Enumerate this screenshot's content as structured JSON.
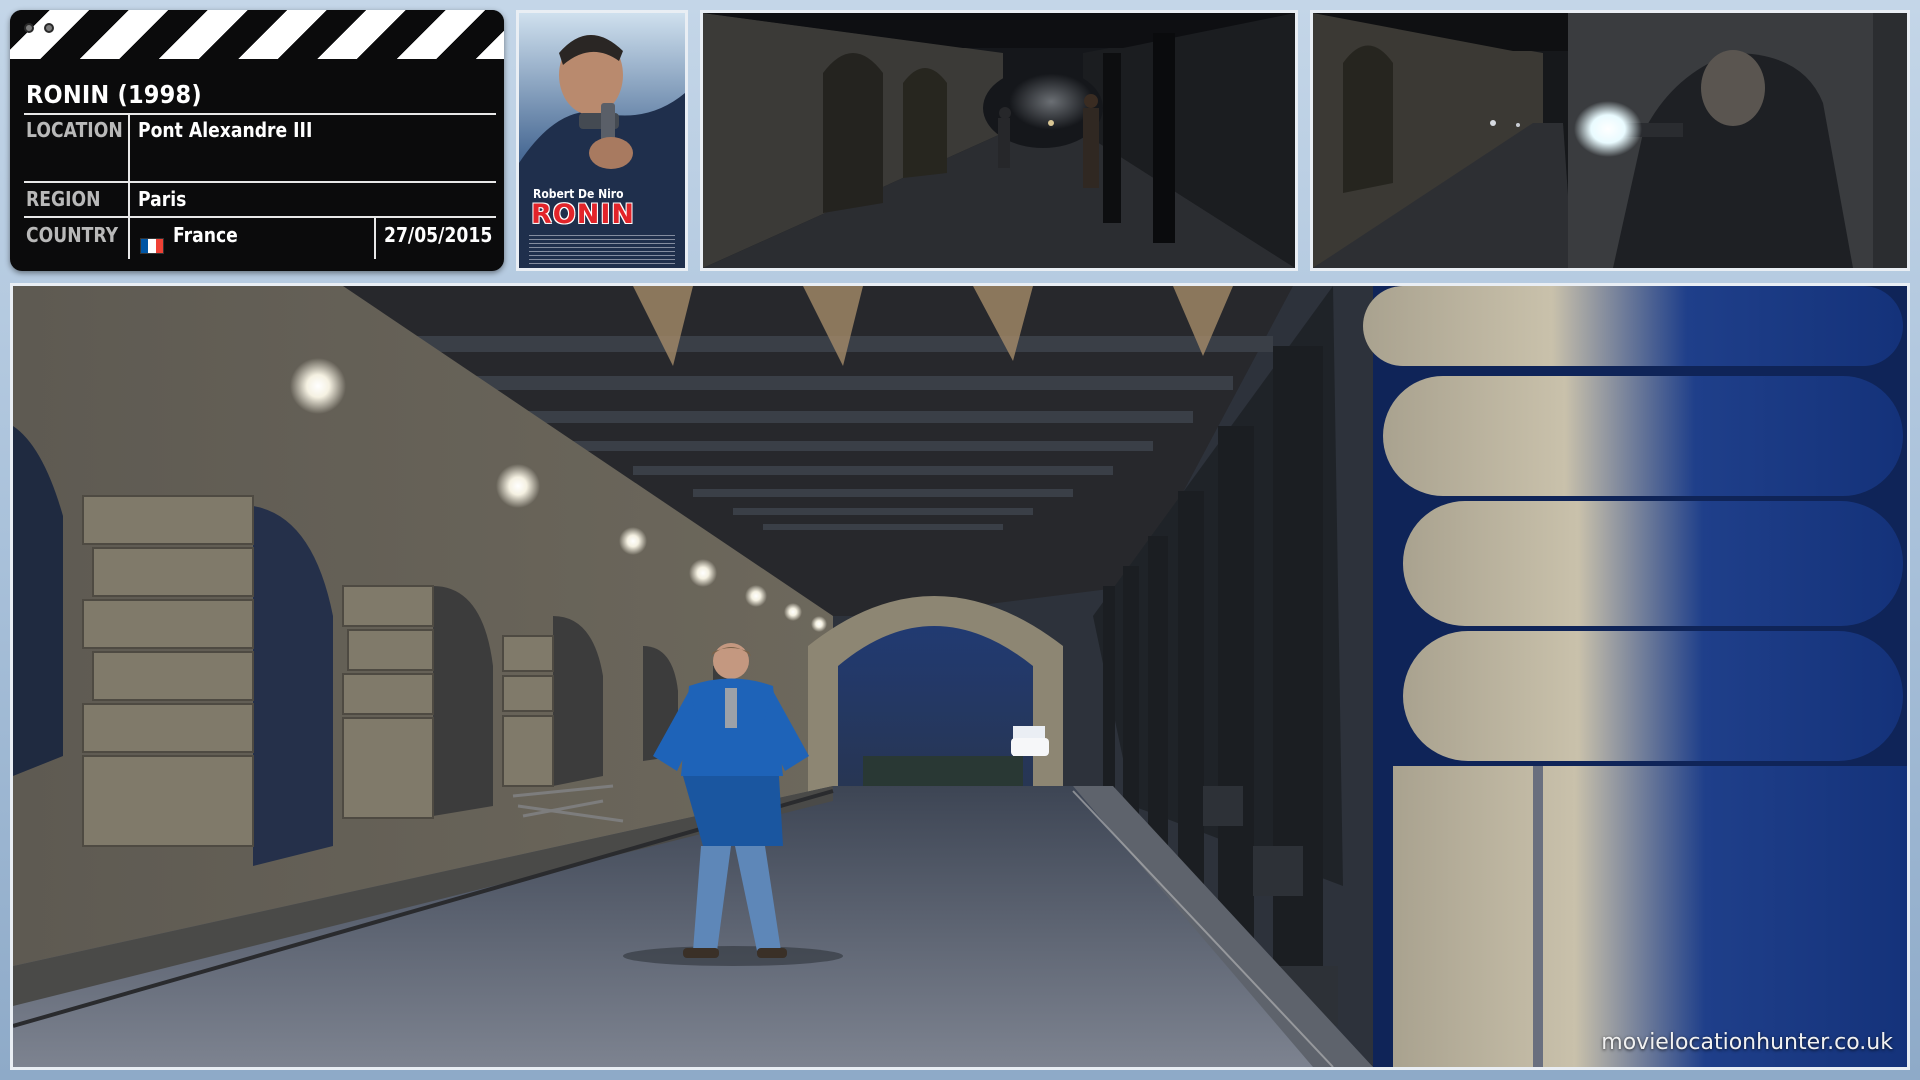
{
  "clapperboard": {
    "title": "RONIN (1998)",
    "rows": [
      {
        "label": "LOCATION",
        "value": "Pont Alexandre III"
      },
      {
        "label": "REGION",
        "value": "Paris"
      },
      {
        "label": "COUNTRY",
        "value": "France"
      }
    ],
    "date": "27/05/2015",
    "country_flag": {
      "icon": "france-flag-icon",
      "colors": [
        "#0055a4",
        "#ffffff",
        "#ef4135"
      ]
    }
  },
  "poster": {
    "actor": "Robert De Niro",
    "film_title": "RONIN"
  },
  "watermark": "movielocationhunter.co.uk"
}
